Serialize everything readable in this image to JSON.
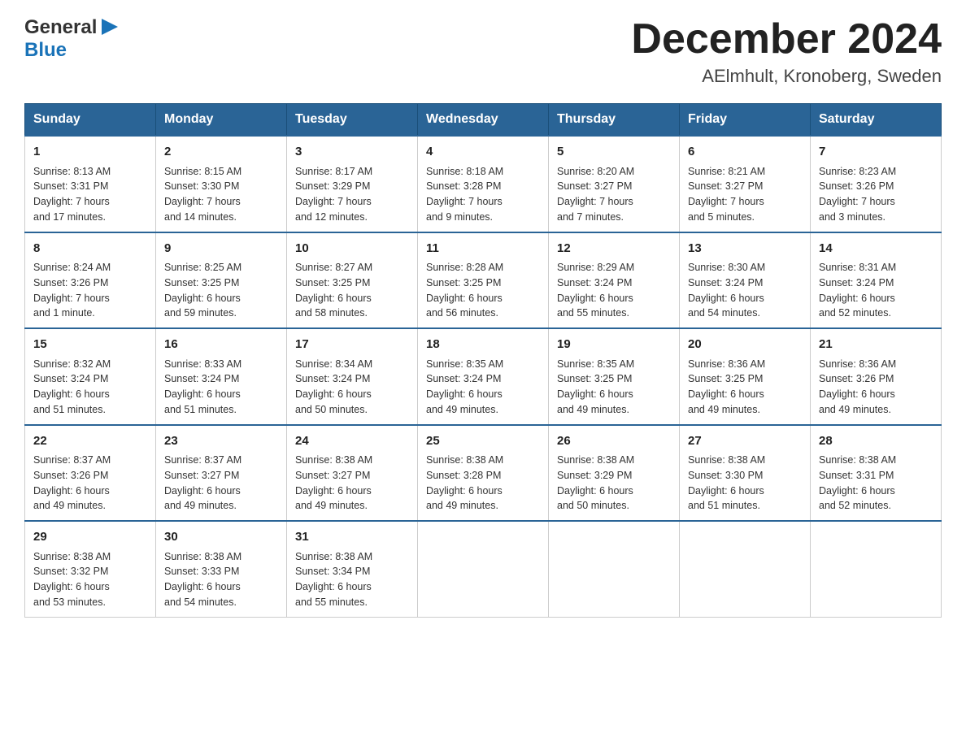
{
  "header": {
    "logo_general": "General",
    "logo_blue": "Blue",
    "month_title": "December 2024",
    "location": "AElmhult, Kronoberg, Sweden"
  },
  "days_of_week": [
    "Sunday",
    "Monday",
    "Tuesday",
    "Wednesday",
    "Thursday",
    "Friday",
    "Saturday"
  ],
  "weeks": [
    [
      {
        "day": "1",
        "sunrise": "Sunrise: 8:13 AM",
        "sunset": "Sunset: 3:31 PM",
        "daylight": "Daylight: 7 hours",
        "daylight2": "and 17 minutes."
      },
      {
        "day": "2",
        "sunrise": "Sunrise: 8:15 AM",
        "sunset": "Sunset: 3:30 PM",
        "daylight": "Daylight: 7 hours",
        "daylight2": "and 14 minutes."
      },
      {
        "day": "3",
        "sunrise": "Sunrise: 8:17 AM",
        "sunset": "Sunset: 3:29 PM",
        "daylight": "Daylight: 7 hours",
        "daylight2": "and 12 minutes."
      },
      {
        "day": "4",
        "sunrise": "Sunrise: 8:18 AM",
        "sunset": "Sunset: 3:28 PM",
        "daylight": "Daylight: 7 hours",
        "daylight2": "and 9 minutes."
      },
      {
        "day": "5",
        "sunrise": "Sunrise: 8:20 AM",
        "sunset": "Sunset: 3:27 PM",
        "daylight": "Daylight: 7 hours",
        "daylight2": "and 7 minutes."
      },
      {
        "day": "6",
        "sunrise": "Sunrise: 8:21 AM",
        "sunset": "Sunset: 3:27 PM",
        "daylight": "Daylight: 7 hours",
        "daylight2": "and 5 minutes."
      },
      {
        "day": "7",
        "sunrise": "Sunrise: 8:23 AM",
        "sunset": "Sunset: 3:26 PM",
        "daylight": "Daylight: 7 hours",
        "daylight2": "and 3 minutes."
      }
    ],
    [
      {
        "day": "8",
        "sunrise": "Sunrise: 8:24 AM",
        "sunset": "Sunset: 3:26 PM",
        "daylight": "Daylight: 7 hours",
        "daylight2": "and 1 minute."
      },
      {
        "day": "9",
        "sunrise": "Sunrise: 8:25 AM",
        "sunset": "Sunset: 3:25 PM",
        "daylight": "Daylight: 6 hours",
        "daylight2": "and 59 minutes."
      },
      {
        "day": "10",
        "sunrise": "Sunrise: 8:27 AM",
        "sunset": "Sunset: 3:25 PM",
        "daylight": "Daylight: 6 hours",
        "daylight2": "and 58 minutes."
      },
      {
        "day": "11",
        "sunrise": "Sunrise: 8:28 AM",
        "sunset": "Sunset: 3:25 PM",
        "daylight": "Daylight: 6 hours",
        "daylight2": "and 56 minutes."
      },
      {
        "day": "12",
        "sunrise": "Sunrise: 8:29 AM",
        "sunset": "Sunset: 3:24 PM",
        "daylight": "Daylight: 6 hours",
        "daylight2": "and 55 minutes."
      },
      {
        "day": "13",
        "sunrise": "Sunrise: 8:30 AM",
        "sunset": "Sunset: 3:24 PM",
        "daylight": "Daylight: 6 hours",
        "daylight2": "and 54 minutes."
      },
      {
        "day": "14",
        "sunrise": "Sunrise: 8:31 AM",
        "sunset": "Sunset: 3:24 PM",
        "daylight": "Daylight: 6 hours",
        "daylight2": "and 52 minutes."
      }
    ],
    [
      {
        "day": "15",
        "sunrise": "Sunrise: 8:32 AM",
        "sunset": "Sunset: 3:24 PM",
        "daylight": "Daylight: 6 hours",
        "daylight2": "and 51 minutes."
      },
      {
        "day": "16",
        "sunrise": "Sunrise: 8:33 AM",
        "sunset": "Sunset: 3:24 PM",
        "daylight": "Daylight: 6 hours",
        "daylight2": "and 51 minutes."
      },
      {
        "day": "17",
        "sunrise": "Sunrise: 8:34 AM",
        "sunset": "Sunset: 3:24 PM",
        "daylight": "Daylight: 6 hours",
        "daylight2": "and 50 minutes."
      },
      {
        "day": "18",
        "sunrise": "Sunrise: 8:35 AM",
        "sunset": "Sunset: 3:24 PM",
        "daylight": "Daylight: 6 hours",
        "daylight2": "and 49 minutes."
      },
      {
        "day": "19",
        "sunrise": "Sunrise: 8:35 AM",
        "sunset": "Sunset: 3:25 PM",
        "daylight": "Daylight: 6 hours",
        "daylight2": "and 49 minutes."
      },
      {
        "day": "20",
        "sunrise": "Sunrise: 8:36 AM",
        "sunset": "Sunset: 3:25 PM",
        "daylight": "Daylight: 6 hours",
        "daylight2": "and 49 minutes."
      },
      {
        "day": "21",
        "sunrise": "Sunrise: 8:36 AM",
        "sunset": "Sunset: 3:26 PM",
        "daylight": "Daylight: 6 hours",
        "daylight2": "and 49 minutes."
      }
    ],
    [
      {
        "day": "22",
        "sunrise": "Sunrise: 8:37 AM",
        "sunset": "Sunset: 3:26 PM",
        "daylight": "Daylight: 6 hours",
        "daylight2": "and 49 minutes."
      },
      {
        "day": "23",
        "sunrise": "Sunrise: 8:37 AM",
        "sunset": "Sunset: 3:27 PM",
        "daylight": "Daylight: 6 hours",
        "daylight2": "and 49 minutes."
      },
      {
        "day": "24",
        "sunrise": "Sunrise: 8:38 AM",
        "sunset": "Sunset: 3:27 PM",
        "daylight": "Daylight: 6 hours",
        "daylight2": "and 49 minutes."
      },
      {
        "day": "25",
        "sunrise": "Sunrise: 8:38 AM",
        "sunset": "Sunset: 3:28 PM",
        "daylight": "Daylight: 6 hours",
        "daylight2": "and 49 minutes."
      },
      {
        "day": "26",
        "sunrise": "Sunrise: 8:38 AM",
        "sunset": "Sunset: 3:29 PM",
        "daylight": "Daylight: 6 hours",
        "daylight2": "and 50 minutes."
      },
      {
        "day": "27",
        "sunrise": "Sunrise: 8:38 AM",
        "sunset": "Sunset: 3:30 PM",
        "daylight": "Daylight: 6 hours",
        "daylight2": "and 51 minutes."
      },
      {
        "day": "28",
        "sunrise": "Sunrise: 8:38 AM",
        "sunset": "Sunset: 3:31 PM",
        "daylight": "Daylight: 6 hours",
        "daylight2": "and 52 minutes."
      }
    ],
    [
      {
        "day": "29",
        "sunrise": "Sunrise: 8:38 AM",
        "sunset": "Sunset: 3:32 PM",
        "daylight": "Daylight: 6 hours",
        "daylight2": "and 53 minutes."
      },
      {
        "day": "30",
        "sunrise": "Sunrise: 8:38 AM",
        "sunset": "Sunset: 3:33 PM",
        "daylight": "Daylight: 6 hours",
        "daylight2": "and 54 minutes."
      },
      {
        "day": "31",
        "sunrise": "Sunrise: 8:38 AM",
        "sunset": "Sunset: 3:34 PM",
        "daylight": "Daylight: 6 hours",
        "daylight2": "and 55 minutes."
      },
      null,
      null,
      null,
      null
    ]
  ],
  "colors": {
    "header_bg": "#2a6496",
    "header_text": "#ffffff",
    "border": "#2a6496"
  }
}
